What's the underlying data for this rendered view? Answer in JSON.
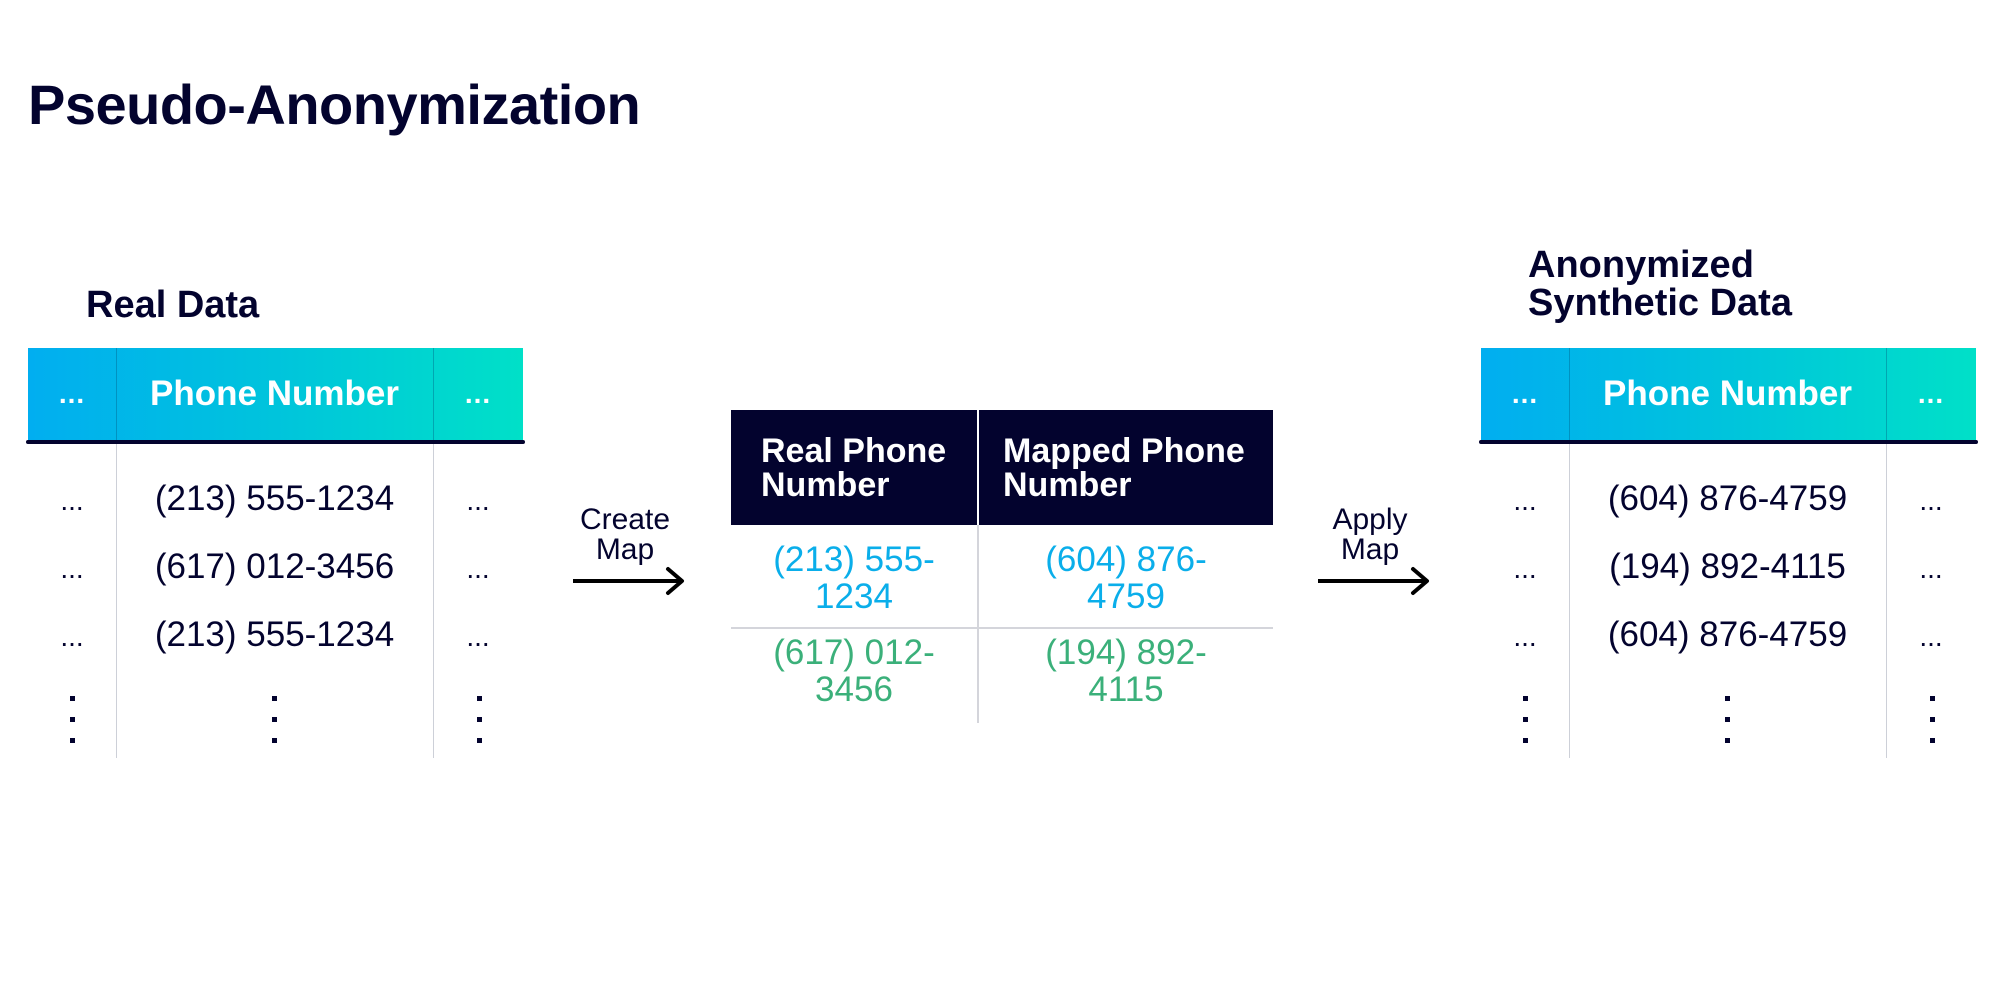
{
  "title": "Pseudo-Anonymization",
  "colors": {
    "navy": "#03032e",
    "gradient_start": "#01aef0",
    "gradient_end": "#00e0c8",
    "real_highlight": "#0aaeea",
    "mapped_highlight": "#3bb07a"
  },
  "real_data": {
    "title": "Real Data",
    "columns": [
      "...",
      "Phone Number",
      "..."
    ],
    "rows": [
      [
        "...",
        "(213) 555-1234",
        "..."
      ],
      [
        "...",
        "(617) 012-3456",
        "..."
      ],
      [
        "...",
        "(213) 555-1234",
        "..."
      ]
    ],
    "continuation": "vertical-ellipsis"
  },
  "create_map": {
    "label_line1": "Create",
    "label_line2": "Map",
    "icon": "arrow-right-icon"
  },
  "mapping_table": {
    "columns": [
      "Real Phone Number",
      "Mapped Phone Number"
    ],
    "header_lines": [
      [
        "Real Phone",
        "Number"
      ],
      [
        "Mapped Phone",
        "Number"
      ]
    ],
    "rows": [
      {
        "real": "(213) 555-1234",
        "real_lines": [
          "(213) 555-",
          "1234"
        ],
        "mapped": "(604) 876-4759",
        "mapped_lines": [
          "(604) 876-",
          "4759"
        ],
        "color": "cyan"
      },
      {
        "real": "(617) 012-3456",
        "real_lines": [
          "(617) 012-",
          "3456"
        ],
        "mapped": "(194) 892-4115",
        "mapped_lines": [
          "(194) 892-",
          "4115"
        ],
        "color": "green"
      }
    ]
  },
  "apply_map": {
    "label_line1": "Apply",
    "label_line2": "Map",
    "icon": "arrow-right-icon"
  },
  "anonymized_data": {
    "title_line1": "Anonymized",
    "title_line2": "Synthetic Data",
    "columns": [
      "...",
      "Phone Number",
      "..."
    ],
    "rows": [
      [
        "...",
        "(604) 876-4759",
        "..."
      ],
      [
        "...",
        "(194) 892-4115",
        "..."
      ],
      [
        "...",
        "(604) 876-4759",
        "..."
      ]
    ],
    "continuation": "vertical-ellipsis"
  }
}
